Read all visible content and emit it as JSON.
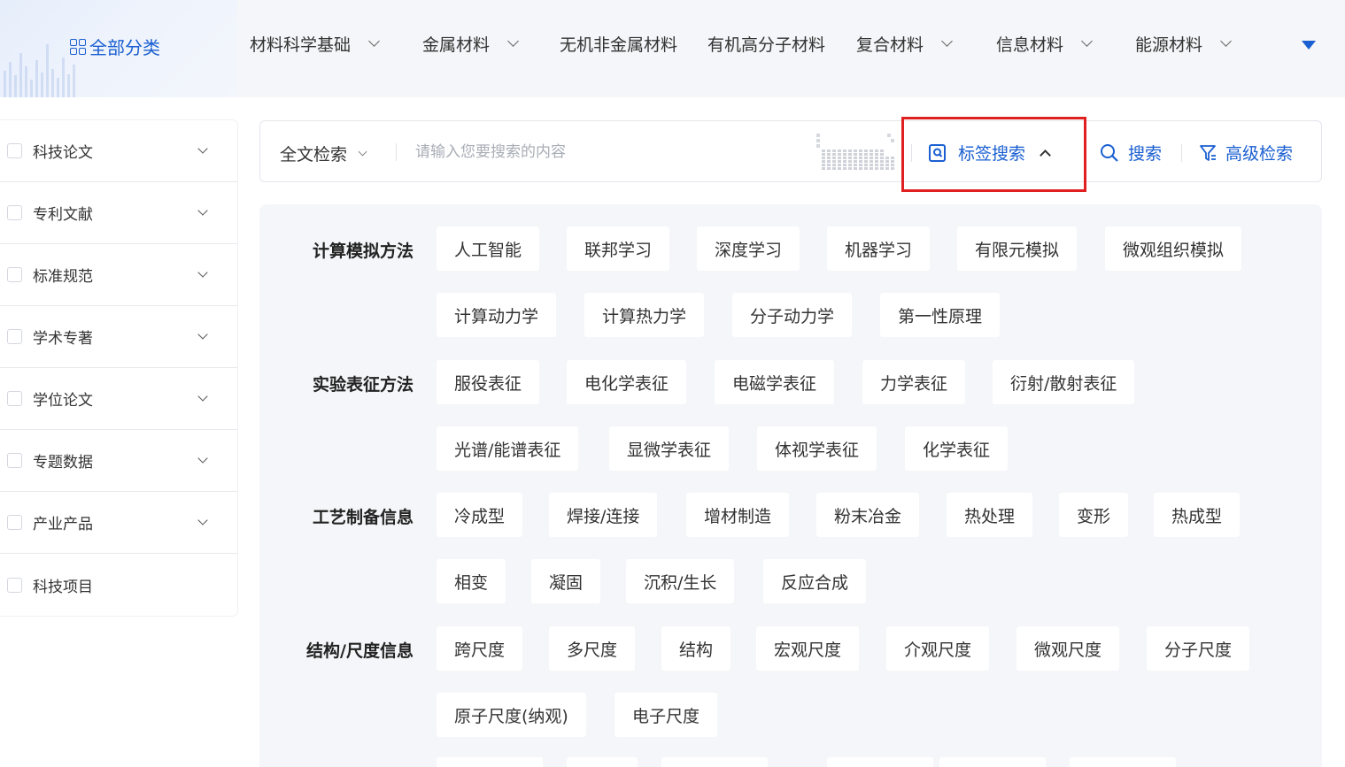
{
  "top_nav": {
    "all_categories": "全部分类",
    "categories": [
      "材料科学基础",
      "金属材料",
      "无机非金属材料",
      "有机高分子材料",
      "复合材料",
      "信息材料",
      "能源材料"
    ]
  },
  "sidebar": {
    "items": [
      {
        "label": "科技论文"
      },
      {
        "label": "专利文献"
      },
      {
        "label": "标准规范"
      },
      {
        "label": "学术专著"
      },
      {
        "label": "学位论文"
      },
      {
        "label": "专题数据"
      },
      {
        "label": "产业产品"
      },
      {
        "label": "科技项目"
      }
    ]
  },
  "search": {
    "scope": "全文检索",
    "placeholder": "请输入您要搜索的内容",
    "tag_search_label": "标签搜索",
    "search_label": "搜索",
    "advanced_label": "高级检索"
  },
  "tag_groups": [
    {
      "label": "计算模拟方法",
      "tags": [
        "人工智能",
        "联邦学习",
        "深度学习",
        "机器学习",
        "有限元模拟",
        "微观组织模拟",
        "计算动力学",
        "计算热力学",
        "分子动力学",
        "第一性原理"
      ]
    },
    {
      "label": "实验表征方法",
      "tags": [
        "服役表征",
        "电化学表征",
        "电磁学表征",
        "力学表征",
        "衍射/散射表征",
        "光谱/能谱表征",
        "显微学表征",
        "体视学表征",
        "化学表征"
      ]
    },
    {
      "label": "工艺制备信息",
      "tags": [
        "冷成型",
        "焊接/连接",
        "增材制造",
        "粉末冶金",
        "热处理",
        "变形",
        "热成型",
        "相变",
        "凝固",
        "沉积/生长",
        "反应合成"
      ]
    },
    {
      "label": "结构/尺度信息",
      "tags": [
        "跨尺度",
        "多尺度",
        "结构",
        "宏观尺度",
        "介观尺度",
        "微观尺度",
        "分子尺度",
        "原子尺度(纳观)",
        "电子尺度"
      ]
    }
  ],
  "colors": {
    "accent": "#1a5fd1",
    "highlight": "#e02020",
    "panel_bg": "#f5f6f9"
  }
}
